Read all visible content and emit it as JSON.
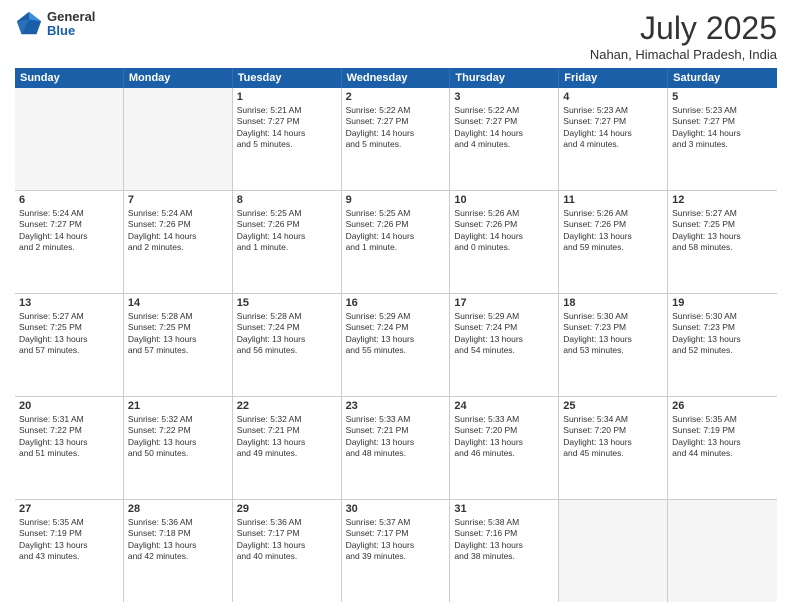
{
  "header": {
    "logo_general": "General",
    "logo_blue": "Blue",
    "month_year": "July 2025",
    "location": "Nahan, Himachal Pradesh, India"
  },
  "days_of_week": [
    "Sunday",
    "Monday",
    "Tuesday",
    "Wednesday",
    "Thursday",
    "Friday",
    "Saturday"
  ],
  "weeks": [
    [
      {
        "day": "",
        "empty": true
      },
      {
        "day": "",
        "empty": true
      },
      {
        "day": "1",
        "line1": "Sunrise: 5:21 AM",
        "line2": "Sunset: 7:27 PM",
        "line3": "Daylight: 14 hours",
        "line4": "and 5 minutes."
      },
      {
        "day": "2",
        "line1": "Sunrise: 5:22 AM",
        "line2": "Sunset: 7:27 PM",
        "line3": "Daylight: 14 hours",
        "line4": "and 5 minutes."
      },
      {
        "day": "3",
        "line1": "Sunrise: 5:22 AM",
        "line2": "Sunset: 7:27 PM",
        "line3": "Daylight: 14 hours",
        "line4": "and 4 minutes."
      },
      {
        "day": "4",
        "line1": "Sunrise: 5:23 AM",
        "line2": "Sunset: 7:27 PM",
        "line3": "Daylight: 14 hours",
        "line4": "and 4 minutes."
      },
      {
        "day": "5",
        "line1": "Sunrise: 5:23 AM",
        "line2": "Sunset: 7:27 PM",
        "line3": "Daylight: 14 hours",
        "line4": "and 3 minutes."
      }
    ],
    [
      {
        "day": "6",
        "line1": "Sunrise: 5:24 AM",
        "line2": "Sunset: 7:27 PM",
        "line3": "Daylight: 14 hours",
        "line4": "and 2 minutes."
      },
      {
        "day": "7",
        "line1": "Sunrise: 5:24 AM",
        "line2": "Sunset: 7:26 PM",
        "line3": "Daylight: 14 hours",
        "line4": "and 2 minutes."
      },
      {
        "day": "8",
        "line1": "Sunrise: 5:25 AM",
        "line2": "Sunset: 7:26 PM",
        "line3": "Daylight: 14 hours",
        "line4": "and 1 minute."
      },
      {
        "day": "9",
        "line1": "Sunrise: 5:25 AM",
        "line2": "Sunset: 7:26 PM",
        "line3": "Daylight: 14 hours",
        "line4": "and 1 minute."
      },
      {
        "day": "10",
        "line1": "Sunrise: 5:26 AM",
        "line2": "Sunset: 7:26 PM",
        "line3": "Daylight: 14 hours",
        "line4": "and 0 minutes."
      },
      {
        "day": "11",
        "line1": "Sunrise: 5:26 AM",
        "line2": "Sunset: 7:26 PM",
        "line3": "Daylight: 13 hours",
        "line4": "and 59 minutes."
      },
      {
        "day": "12",
        "line1": "Sunrise: 5:27 AM",
        "line2": "Sunset: 7:25 PM",
        "line3": "Daylight: 13 hours",
        "line4": "and 58 minutes."
      }
    ],
    [
      {
        "day": "13",
        "line1": "Sunrise: 5:27 AM",
        "line2": "Sunset: 7:25 PM",
        "line3": "Daylight: 13 hours",
        "line4": "and 57 minutes."
      },
      {
        "day": "14",
        "line1": "Sunrise: 5:28 AM",
        "line2": "Sunset: 7:25 PM",
        "line3": "Daylight: 13 hours",
        "line4": "and 57 minutes."
      },
      {
        "day": "15",
        "line1": "Sunrise: 5:28 AM",
        "line2": "Sunset: 7:24 PM",
        "line3": "Daylight: 13 hours",
        "line4": "and 56 minutes."
      },
      {
        "day": "16",
        "line1": "Sunrise: 5:29 AM",
        "line2": "Sunset: 7:24 PM",
        "line3": "Daylight: 13 hours",
        "line4": "and 55 minutes."
      },
      {
        "day": "17",
        "line1": "Sunrise: 5:29 AM",
        "line2": "Sunset: 7:24 PM",
        "line3": "Daylight: 13 hours",
        "line4": "and 54 minutes."
      },
      {
        "day": "18",
        "line1": "Sunrise: 5:30 AM",
        "line2": "Sunset: 7:23 PM",
        "line3": "Daylight: 13 hours",
        "line4": "and 53 minutes."
      },
      {
        "day": "19",
        "line1": "Sunrise: 5:30 AM",
        "line2": "Sunset: 7:23 PM",
        "line3": "Daylight: 13 hours",
        "line4": "and 52 minutes."
      }
    ],
    [
      {
        "day": "20",
        "line1": "Sunrise: 5:31 AM",
        "line2": "Sunset: 7:22 PM",
        "line3": "Daylight: 13 hours",
        "line4": "and 51 minutes."
      },
      {
        "day": "21",
        "line1": "Sunrise: 5:32 AM",
        "line2": "Sunset: 7:22 PM",
        "line3": "Daylight: 13 hours",
        "line4": "and 50 minutes."
      },
      {
        "day": "22",
        "line1": "Sunrise: 5:32 AM",
        "line2": "Sunset: 7:21 PM",
        "line3": "Daylight: 13 hours",
        "line4": "and 49 minutes."
      },
      {
        "day": "23",
        "line1": "Sunrise: 5:33 AM",
        "line2": "Sunset: 7:21 PM",
        "line3": "Daylight: 13 hours",
        "line4": "and 48 minutes."
      },
      {
        "day": "24",
        "line1": "Sunrise: 5:33 AM",
        "line2": "Sunset: 7:20 PM",
        "line3": "Daylight: 13 hours",
        "line4": "and 46 minutes."
      },
      {
        "day": "25",
        "line1": "Sunrise: 5:34 AM",
        "line2": "Sunset: 7:20 PM",
        "line3": "Daylight: 13 hours",
        "line4": "and 45 minutes."
      },
      {
        "day": "26",
        "line1": "Sunrise: 5:35 AM",
        "line2": "Sunset: 7:19 PM",
        "line3": "Daylight: 13 hours",
        "line4": "and 44 minutes."
      }
    ],
    [
      {
        "day": "27",
        "line1": "Sunrise: 5:35 AM",
        "line2": "Sunset: 7:19 PM",
        "line3": "Daylight: 13 hours",
        "line4": "and 43 minutes."
      },
      {
        "day": "28",
        "line1": "Sunrise: 5:36 AM",
        "line2": "Sunset: 7:18 PM",
        "line3": "Daylight: 13 hours",
        "line4": "and 42 minutes."
      },
      {
        "day": "29",
        "line1": "Sunrise: 5:36 AM",
        "line2": "Sunset: 7:17 PM",
        "line3": "Daylight: 13 hours",
        "line4": "and 40 minutes."
      },
      {
        "day": "30",
        "line1": "Sunrise: 5:37 AM",
        "line2": "Sunset: 7:17 PM",
        "line3": "Daylight: 13 hours",
        "line4": "and 39 minutes."
      },
      {
        "day": "31",
        "line1": "Sunrise: 5:38 AM",
        "line2": "Sunset: 7:16 PM",
        "line3": "Daylight: 13 hours",
        "line4": "and 38 minutes."
      },
      {
        "day": "",
        "empty": true
      },
      {
        "day": "",
        "empty": true
      }
    ]
  ]
}
